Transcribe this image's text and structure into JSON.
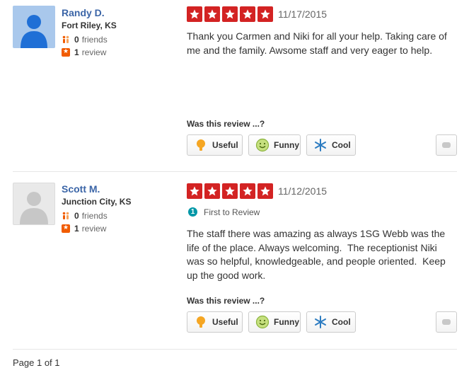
{
  "reviews": [
    {
      "user": {
        "name": "Randy D.",
        "location": "Fort Riley, KS",
        "friends_count": "0",
        "friends_label": "friends",
        "review_count": "1",
        "review_label": "review"
      },
      "rating": 5,
      "date": "11/17/2015",
      "badge": null,
      "text": "Thank you Carmen and Niki for all your help. Taking care of me and the family. Awsome staff and very eager to help.",
      "vote_prompt": "Was this review ...?",
      "votes": {
        "useful": "Useful",
        "funny": "Funny",
        "cool": "Cool"
      }
    },
    {
      "user": {
        "name": "Scott M.",
        "location": "Junction City, KS",
        "friends_count": "0",
        "friends_label": "friends",
        "review_count": "1",
        "review_label": "review"
      },
      "rating": 5,
      "date": "11/12/2015",
      "badge": "First to Review",
      "text": "The staff there was amazing as always 1SG Webb was the life of the place. Always welcoming.  The receptionist Niki was so helpful, knowledgeable, and people oriented.  Keep up the good work.",
      "vote_prompt": "Was this review ...?",
      "votes": {
        "useful": "Useful",
        "funny": "Funny",
        "cool": "Cool"
      }
    }
  ],
  "pagination": {
    "label": "Page 1 of 1"
  },
  "colors": {
    "star_red": "#d32323",
    "link_blue": "#3b65a7",
    "review_orange": "#f15c00",
    "badge_teal": "#0097a7"
  }
}
